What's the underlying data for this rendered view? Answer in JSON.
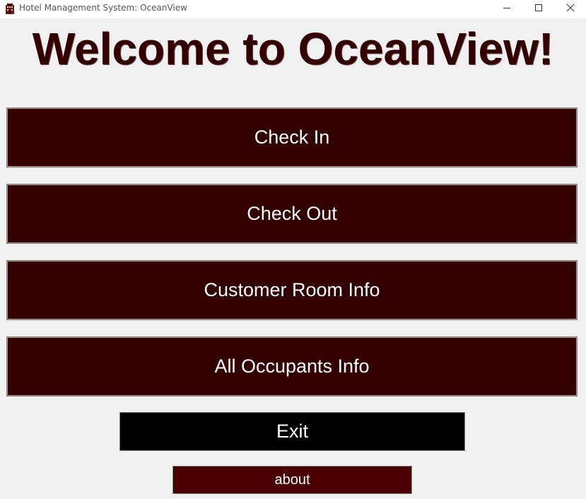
{
  "window": {
    "title": "Hotel Management System: OceanView",
    "icon": "hotel-building-icon",
    "controls": [
      "minimize-icon",
      "maximize-icon",
      "close-icon"
    ]
  },
  "header": {
    "title": "Welcome to OceanView!"
  },
  "menu": {
    "check_in": "Check In",
    "check_out": "Check Out",
    "customer_room_info": "Customer Room Info",
    "all_occupants_info": "All Occupants Info",
    "exit": "Exit",
    "about": "about"
  },
  "colors": {
    "background": "#f0f0f0",
    "button_bg": "#330000",
    "exit_bg": "#000000",
    "about_bg": "#4a0000",
    "heading_text": "#330000",
    "button_text": "#ffffff"
  }
}
